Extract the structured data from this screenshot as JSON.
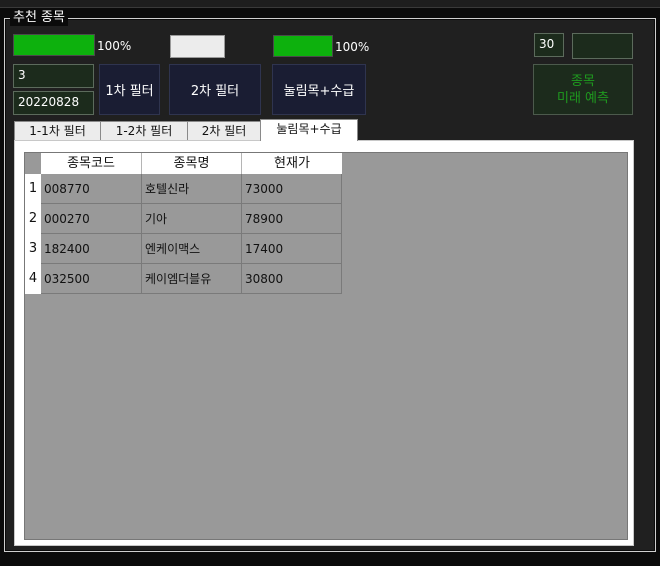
{
  "group": {
    "title": "추천 종목"
  },
  "progress": [
    {
      "value": 1.0,
      "label": "100%"
    },
    {
      "value": 1.0,
      "label": "100%"
    }
  ],
  "inputs": {
    "count": "3",
    "date": "20220828",
    "days": "30"
  },
  "buttons": {
    "filter1": "1차 필터",
    "filter2": "2차 필터",
    "filter3": "눌림목+수급",
    "predict_line1": "종목",
    "predict_line2": "미래 예측"
  },
  "tabs": [
    "1-1차 필터",
    "1-2차 필터",
    "2차 필터",
    "눌림목+수급"
  ],
  "table": {
    "columns": [
      "종목코드",
      "종목명",
      "현재가"
    ],
    "rows": [
      {
        "num": "1",
        "code": "008770",
        "name": "호텔신라",
        "price": "73000"
      },
      {
        "num": "2",
        "code": "000270",
        "name": "기아",
        "price": "78900"
      },
      {
        "num": "3",
        "code": "182400",
        "name": "엔케이맥스",
        "price": "17400"
      },
      {
        "num": "4",
        "code": "032500",
        "name": "케이엠더블유",
        "price": "30800"
      }
    ]
  },
  "colors": {
    "progress_fill": "#0db10d",
    "button_bg": "#1a1d33",
    "predict_text": "#1f9a1f",
    "grid_bg": "#999999"
  }
}
